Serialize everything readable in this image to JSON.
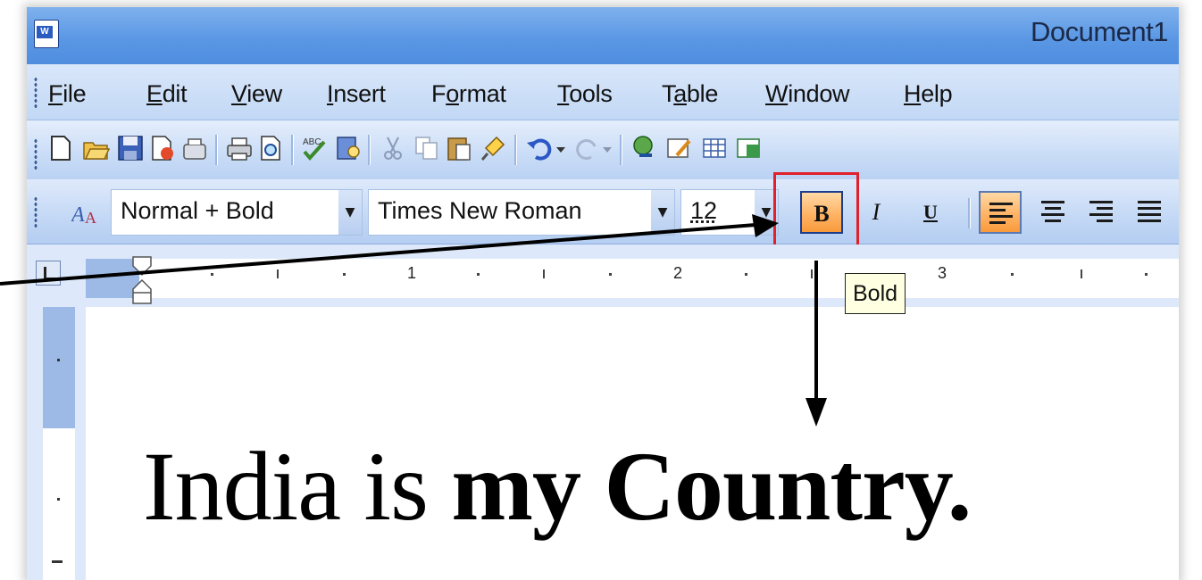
{
  "window": {
    "title": "Document1"
  },
  "menu": [
    {
      "label": "File",
      "key": "F",
      "rest": "ile"
    },
    {
      "label": "Edit",
      "key": "E",
      "rest": "dit"
    },
    {
      "label": "View",
      "key": "V",
      "rest": "iew"
    },
    {
      "label": "Insert",
      "key": "I",
      "rest": "nsert"
    },
    {
      "label": "Format",
      "pre": "F",
      "key": "o",
      "rest": "rmat"
    },
    {
      "label": "Tools",
      "key": "T",
      "rest": "ools"
    },
    {
      "label": "Table",
      "pre": "T",
      "key": "a",
      "rest": "ble"
    },
    {
      "label": "Window",
      "key": "W",
      "rest": "indow"
    },
    {
      "label": "Help",
      "key": "H",
      "rest": "elp"
    }
  ],
  "formatting": {
    "style": "Normal + Bold",
    "font": "Times New Roman",
    "size": "12",
    "bold_label": "B",
    "italic_label": "I",
    "underline_label": "U",
    "bold_active": true,
    "align_left_active": true
  },
  "ruler": {
    "numbers": [
      "1",
      "2",
      "3"
    ]
  },
  "tooltip": {
    "text": "Bold"
  },
  "document": {
    "text_normal": "India is ",
    "text_bold": "my Country."
  },
  "colors": {
    "titlebar": "#5a97e4",
    "active_button": "#ffb060",
    "highlight_box": "#e0202a"
  }
}
